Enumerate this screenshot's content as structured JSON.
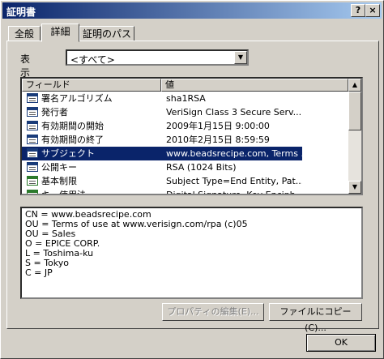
{
  "window": {
    "title": "証明書",
    "help_glyph": "?",
    "close_glyph": "×"
  },
  "tabs": [
    {
      "label": "全般",
      "active": false
    },
    {
      "label": "詳細",
      "active": true
    },
    {
      "label": "証明のパス",
      "active": false
    }
  ],
  "show": {
    "label": "表示(S):",
    "value": "<すべて>"
  },
  "list": {
    "headers": {
      "field": "フィールド",
      "value": "値"
    },
    "rows": [
      {
        "name": "署名アルゴリズム",
        "value": "sha1RSA"
      },
      {
        "name": "発行者",
        "value": "VeriSign Class 3 Secure Serv..."
      },
      {
        "name": "有効期間の開始",
        "value": "2009年1月15日 9:00:00"
      },
      {
        "name": "有効期間の終了",
        "value": "2010年2月15日 8:59:59"
      },
      {
        "name": "サブジェクト",
        "value": "www.beadsrecipe.com, Terms ...",
        "selected": true
      },
      {
        "name": "公開キー",
        "value": "RSA (1024 Bits)"
      },
      {
        "name": "基本制限",
        "value": "Subject Type=End Entity, Pat..."
      },
      {
        "name": "キー使用法",
        "value": "Digital Signature, Key Enciph..."
      }
    ]
  },
  "detail_text": "CN = www.beadsrecipe.com\nOU = Terms of use at www.verisign.com/rpa (c)05\nOU = Sales\nO = EPICE CORP.\nL = Toshima-ku\nS = Tokyo\nC = JP",
  "buttons": {
    "edit_properties": "プロパティの編集(E)...",
    "copy_to_file": "ファイルにコピー(C)...",
    "ok": "OK"
  },
  "icons": {
    "scroll_up": "▲",
    "scroll_down": "▼",
    "dropdown": "▼"
  }
}
